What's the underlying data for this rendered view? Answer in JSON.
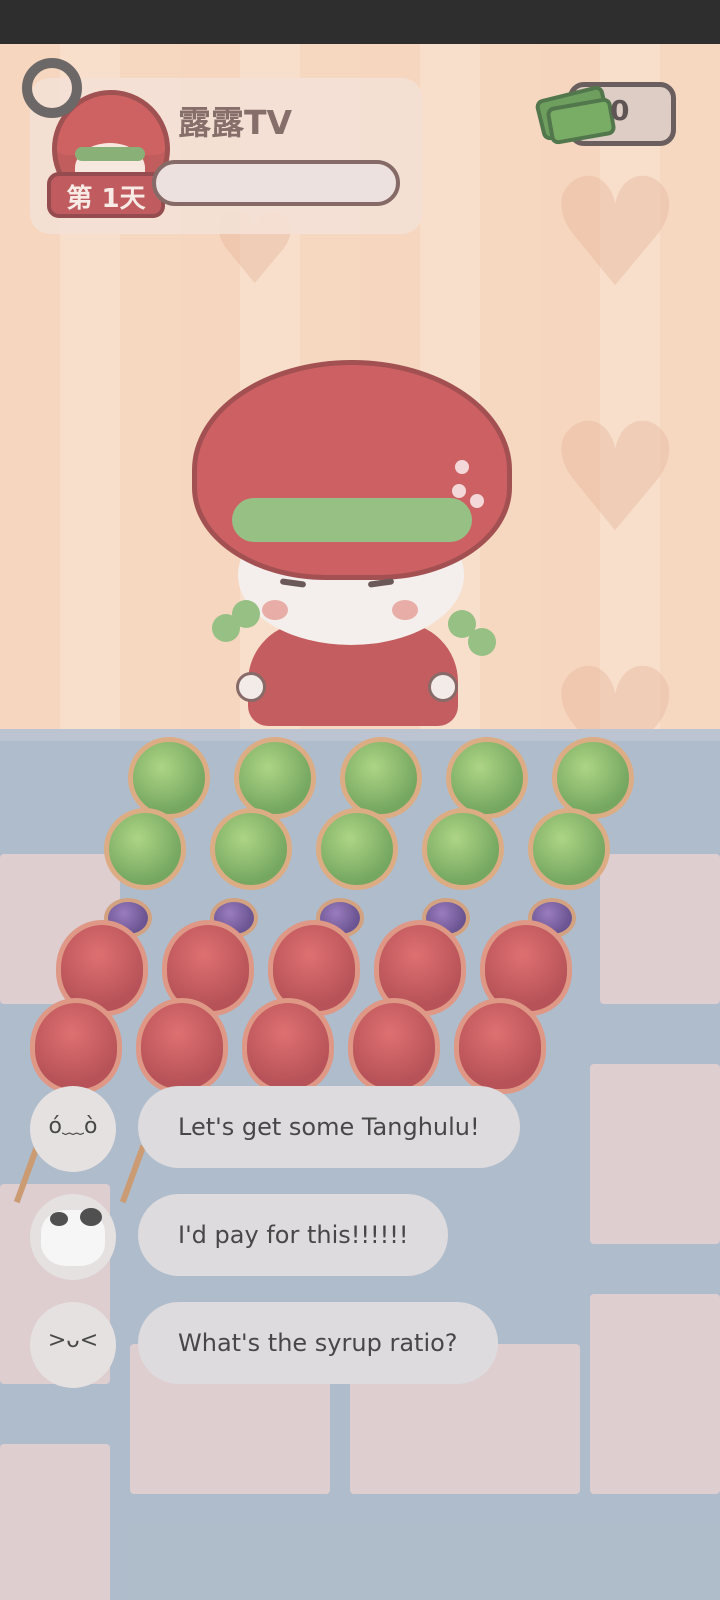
{
  "status_bar": {},
  "header": {
    "channel_name": "露露TV",
    "day_badge": "第 1天",
    "money": "0"
  },
  "character": {
    "name": "strawberry-girl"
  },
  "tanghulu": {
    "sticks": 5,
    "rows": [
      "green",
      "green",
      "purple",
      "red",
      "red"
    ]
  },
  "chat": {
    "messages": [
      {
        "avatar": "sad-face-icon",
        "text": "Let's get some Tanghulu!"
      },
      {
        "avatar": "cow-icon",
        "text": "I'd pay for this!!!!!!"
      },
      {
        "avatar": "smirk-face-icon",
        "text": "What's the syrup ratio?"
      }
    ]
  },
  "colors": {
    "accent": "#c13e40",
    "money_green": "#4f8a3c"
  }
}
